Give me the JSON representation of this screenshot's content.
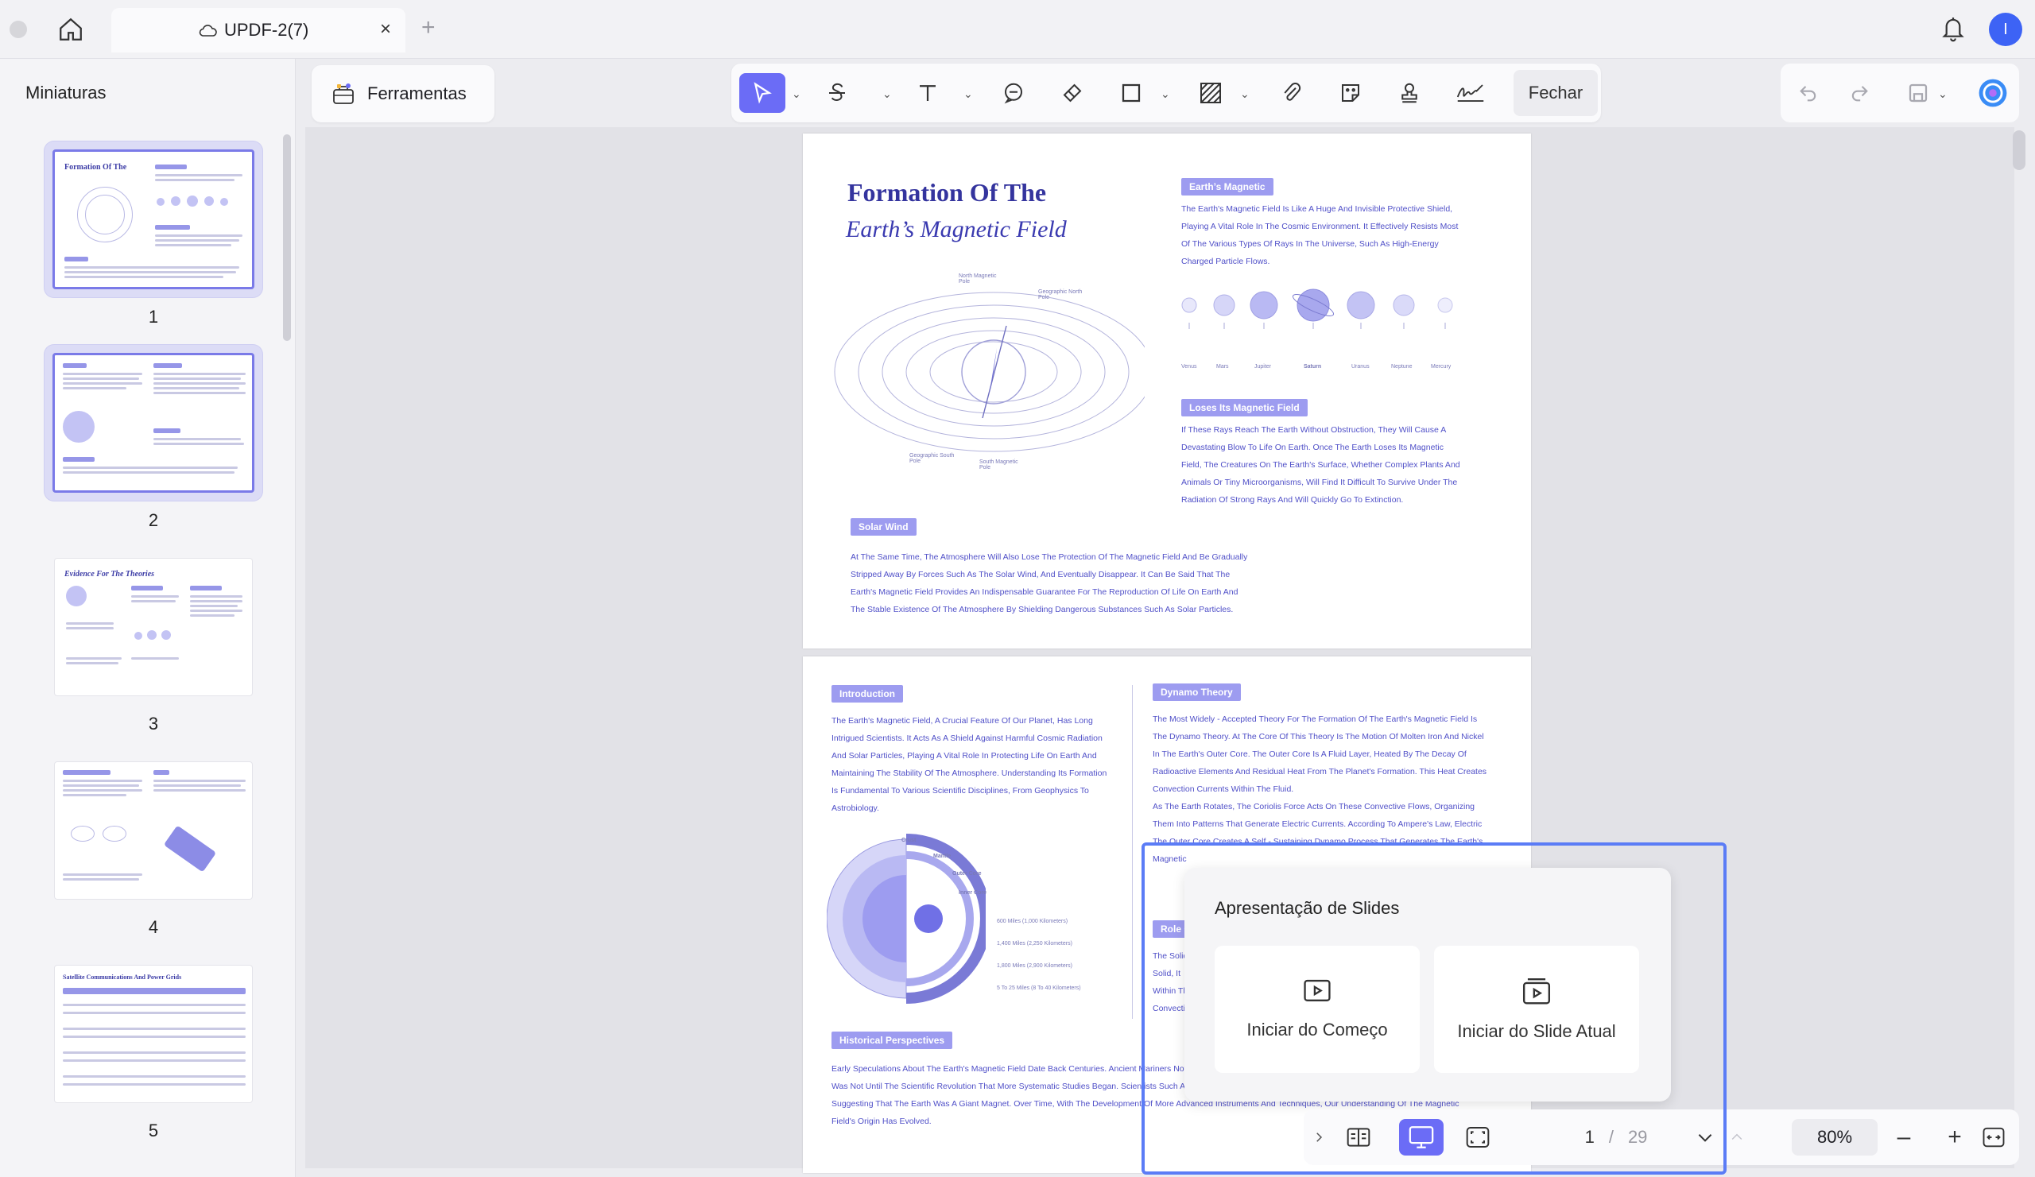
{
  "titlebar": {
    "tab_title": "UPDF-2(7)",
    "close_glyph": "×",
    "new_tab_glyph": "+",
    "avatar_initial": "I",
    "icons": [
      "home-icon",
      "cloud-icon",
      "bell-icon"
    ]
  },
  "sidebar": {
    "title": "Miniaturas",
    "thumbnails": [
      {
        "number": "1",
        "title": "Formation Of The",
        "selected": true
      },
      {
        "number": "2",
        "selected": true
      },
      {
        "number": "3",
        "title": "Evidence For The Theories",
        "selected": false
      },
      {
        "number": "4",
        "selected": false
      },
      {
        "number": "5",
        "title": "Satellite Communications And Power Grids",
        "selected": false
      }
    ]
  },
  "toolbar": {
    "tools_label": "Ferramentas",
    "close_label": "Fechar",
    "tools": [
      "select-icon",
      "strikethrough-icon",
      "text-icon",
      "comment-icon",
      "eraser-icon",
      "rectangle-icon",
      "hatch-icon",
      "attachment-icon",
      "sticker-icon",
      "stamp-icon",
      "signature-icon"
    ]
  },
  "document": {
    "page1": {
      "title_line1": "Formation Of The",
      "title_line2": "Earth’s Magnetic Field",
      "labels": {
        "north_magnetic_pole": "North Magnetic Pole",
        "geographic_north_pole": "Geographic North Pole",
        "geographic_south_pole": "Geographic South Pole",
        "south_magnetic_pole": "South Magnetic Pole"
      },
      "section_earths_magnetic": "Earth’s Magnetic",
      "text_earths_magnetic": [
        "The Earth's Magnetic Field Is Like A Huge And Invisible Protective Shield,",
        "Playing A Vital Role In The Cosmic Environment. It Effectively Resists Most",
        "Of The Various Types Of Rays In The Universe, Such As High-Energy",
        "Charged Particle Flows."
      ],
      "planets": [
        "Venus",
        "Mars",
        "Jupiter",
        "Saturn",
        "Uranus",
        "Neptune",
        "Mercury"
      ],
      "section_loses": "Loses Its Magnetic Field",
      "text_loses": [
        "If These Rays Reach The Earth Without Obstruction, They Will Cause A",
        "Devastating Blow To Life On Earth. Once The Earth Loses Its Magnetic",
        "Field, The Creatures On The Earth's Surface, Whether Complex Plants And",
        "Animals Or Tiny Microorganisms, Will Find It Difficult To Survive Under The",
        "Radiation Of Strong Rays And Will Quickly Go To Extinction."
      ],
      "section_solar": "Solar Wind",
      "text_solar": [
        "At The Same Time, The Atmosphere Will Also Lose The Protection Of The Magnetic Field And Be Gradually",
        "Stripped Away By Forces Such As The Solar Wind, And Eventually Disappear. It Can Be Said That The",
        "Earth's Magnetic Field Provides An Indispensable Guarantee For The Reproduction Of Life On Earth And",
        "The Stable Existence Of The Atmosphere By Shielding Dangerous Substances Such As Solar Particles."
      ]
    },
    "page2": {
      "section_intro": "Introduction",
      "text_intro": [
        "The Earth's Magnetic Field, A Crucial Feature Of Our Planet, Has Long",
        "Intrigued Scientists. It Acts As A Shield Against Harmful Cosmic Radiation",
        "And Solar Particles, Playing A Vital Role In Protecting Life On Earth And",
        "Maintaining The Stability Of The Atmosphere. Understanding Its Formation",
        "Is Fundamental To Various Scientific Disciplines, From Geophysics To",
        "Astrobiology."
      ],
      "section_dynamo": "Dynamo Theory",
      "text_dynamo": [
        "The Most Widely - Accepted Theory For The Formation Of The Earth's Magnetic Field Is",
        "The Dynamo Theory. At The Core Of This Theory Is The Motion Of Molten Iron And Nickel",
        "In The Earth's Outer Core. The Outer Core Is A Fluid Layer, Heated By The Decay Of",
        "Radioactive Elements And Residual Heat From The Planet's Formation. This Heat Creates",
        "Convection Currents Within The Fluid.",
        "As The Earth Rotates, The Coriolis Force Acts On These Convective Flows, Organizing",
        "Them Into Patterns That Generate Electric Currents. According To Ampere's Law, Electric",
        "The Outer Core Creates A Self - Sustaining Dynamo Process That Generates The Earth's",
        "Magnetic"
      ],
      "core_labels": [
        "Crust",
        "Mantle",
        "Outer Core",
        "Inner Core"
      ],
      "distance_labels": [
        "600 Miles (1,000 Kilometers)",
        "1,400 Miles (2,250 Kilometers)",
        "1,800 Miles (2,900 Kilometers)",
        "5 To 25 Miles (8 To 40 Kilometers)"
      ],
      "section_role": "Role O",
      "text_role": [
        "The Solid",
        "Solid, It",
        "Within Th",
        "Convecti"
      ],
      "section_historical": "Historical Perspectives",
      "text_historical": [
        "Early Speculations About The Earth's Magnetic Field Date Back Centuries. Ancient Mariners Noti",
        "Was Not Until The Scientific Revolution That More Systematic Studies Began. Scientists Such As",
        "Suggesting That The Earth Was A Giant Magnet. Over Time, With The Development Of More Advanced Instruments And Techniques, Our Understanding Of The Magnetic",
        "Field's Origin Has Evolved."
      ]
    }
  },
  "popup": {
    "title": "Apresentação de Slides",
    "option_start": "Iniciar do Começo",
    "option_current": "Iniciar do Slide Atual"
  },
  "bottombar": {
    "current_page": "1",
    "separator": "/",
    "total_pages": "29",
    "zoom": "80%",
    "zoom_out": "–",
    "zoom_in": "+"
  },
  "colors": {
    "accent": "#6b6cf6",
    "highlight": "#5b7cf6",
    "doc_text": "#5050c8",
    "doc_heading": "#34349e"
  }
}
